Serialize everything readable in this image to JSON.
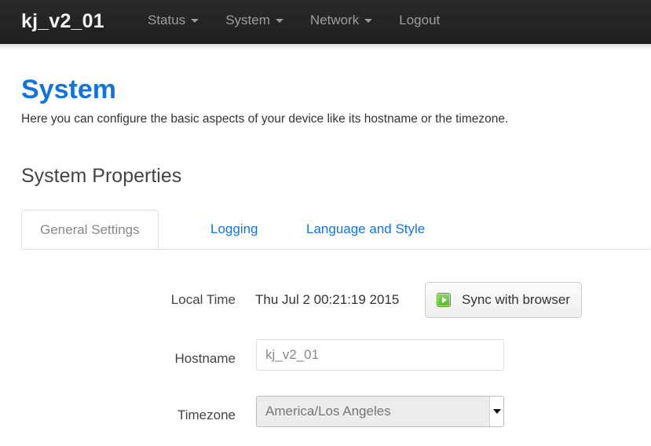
{
  "navbar": {
    "brand": "kj_v2_01",
    "items": [
      {
        "label": "Status",
        "has_caret": true
      },
      {
        "label": "System",
        "has_caret": true
      },
      {
        "label": "Network",
        "has_caret": true
      },
      {
        "label": "Logout",
        "has_caret": false
      }
    ]
  },
  "page": {
    "title": "System",
    "description": "Here you can configure the basic aspects of your device like its hostname or the timezone.",
    "section_title": "System Properties"
  },
  "tabs": [
    {
      "label": "General Settings",
      "active": true
    },
    {
      "label": "Logging",
      "active": false
    },
    {
      "label": "Language and Style",
      "active": false
    }
  ],
  "form": {
    "local_time": {
      "label": "Local Time",
      "value": "Thu Jul 2 00:21:19 2015",
      "button_label": "Sync with browser",
      "button_icon": "play-square-green-icon"
    },
    "hostname": {
      "label": "Hostname",
      "value": "kj_v2_01",
      "placeholder": "kj_v2_01"
    },
    "timezone": {
      "label": "Timezone",
      "value": "America/Los Angeles",
      "arrow_icon": "chevron-down-icon"
    }
  },
  "colors": {
    "navbar_bg": "#222222",
    "title_blue": "#1273de",
    "link_blue": "#1273de",
    "icon_green": "#5cb832"
  }
}
